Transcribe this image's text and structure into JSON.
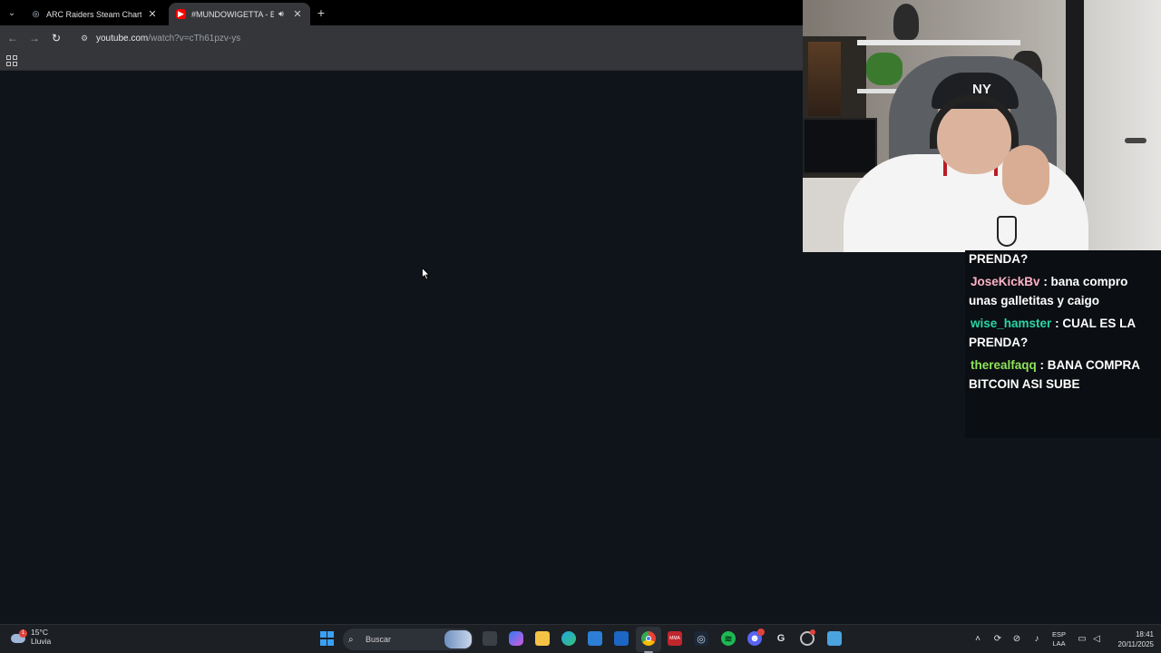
{
  "browser": {
    "tabs": [
      {
        "title": "ARC Raiders Steam Charts - Steam",
        "favicon": "steam-icon",
        "active": false
      },
      {
        "title": "#MUNDOWIGETTA - EL COMIENZO",
        "favicon": "youtube-icon",
        "active": true,
        "audio": true
      }
    ],
    "new_tab_symbol": "+",
    "url_host": "youtube.com",
    "url_path": "/watch?v=cTh61pzv-ys"
  },
  "chat": {
    "partial_top": "PRENDA?",
    "messages": [
      {
        "user": "JoseKickBv",
        "text": ": bana compro unas galletitas y caigo",
        "color": "#ffb3c7"
      },
      {
        "user": "wise_hamster",
        "text": ": CUAL ES LA PRENDA?",
        "color": "#2bd6a6"
      },
      {
        "user": "therealfaqq",
        "text": ": BANA COMPRA BITCOIN ASI SUBE",
        "color": "#8ee35a"
      }
    ]
  },
  "webcam": {
    "cap_logo": "NY"
  },
  "taskbar": {
    "weather_temp": "15°C",
    "weather_desc": "Lluvia",
    "weather_badge": "1",
    "search_placeholder": "Buscar",
    "app1_label": "MMA",
    "language": "ESP",
    "layout": "LAA",
    "time": "18:41",
    "date": "20/11/2025"
  }
}
